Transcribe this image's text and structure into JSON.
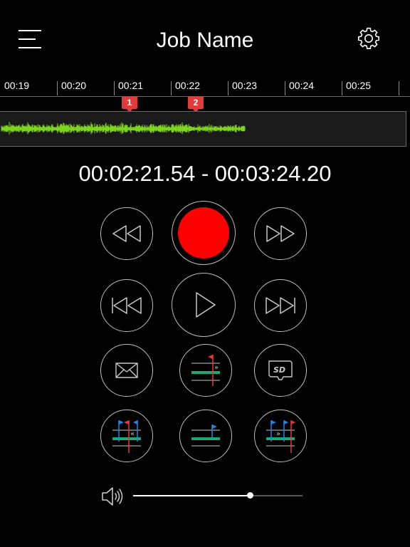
{
  "header": {
    "title": "Job Name"
  },
  "timeline": {
    "ticks": [
      "00:19",
      "00:20",
      "00:21",
      "00:22",
      "00:23",
      "00:24",
      "00:25"
    ],
    "markers": [
      "1",
      "2"
    ]
  },
  "time_range": "00:02:21.54 - 00:03:24.20",
  "colors": {
    "waveform": "#7ed321",
    "record": "#ff0000",
    "marker": "#e23b3b",
    "bookmark_blue": "#1e88e5",
    "bookmark_red": "#e53935",
    "bookmark_green": "#19a974"
  },
  "controls": {
    "row1": [
      "rewind-icon",
      "record-icon",
      "fast-forward-icon"
    ],
    "row2": [
      "skip-back-icon",
      "play-icon",
      "skip-forward-icon"
    ],
    "row3": [
      "mail-icon",
      "marker-forward-icon",
      "sd-card-icon"
    ],
    "row4": [
      "region-back-icon",
      "region-center-icon",
      "region-forward-icon"
    ]
  },
  "volume": {
    "icon": "speaker-icon",
    "level": 0.69
  }
}
